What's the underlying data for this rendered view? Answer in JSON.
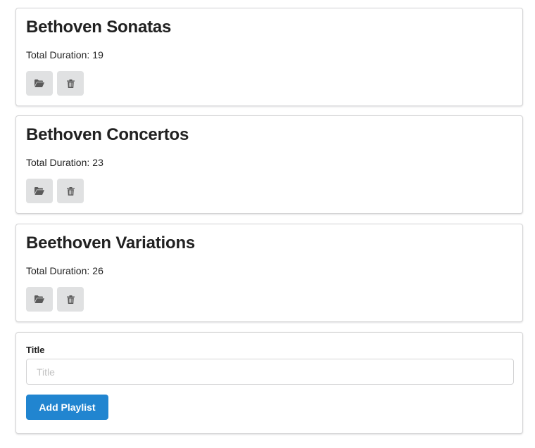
{
  "playlists": [
    {
      "title": "Bethoven Sonatas",
      "duration_label": "Total Duration:",
      "duration_value": "19",
      "open_icon": "folder-open-icon",
      "delete_icon": "trash-icon"
    },
    {
      "title": "Bethoven Concertos",
      "duration_label": "Total Duration:",
      "duration_value": "23",
      "open_icon": "folder-open-icon",
      "delete_icon": "trash-icon"
    },
    {
      "title": "Beethoven Variations",
      "duration_label": "Total Duration:",
      "duration_value": "26",
      "open_icon": "folder-open-icon",
      "delete_icon": "trash-icon"
    }
  ],
  "form": {
    "title_label": "Title",
    "title_placeholder": "Title",
    "title_value": "",
    "submit_label": "Add Playlist"
  },
  "colors": {
    "primary_button": "#2185d0",
    "icon_button_bg": "#e0e1e2",
    "icon_color": "#5a5a5a",
    "card_border": "#d4d4d5"
  }
}
